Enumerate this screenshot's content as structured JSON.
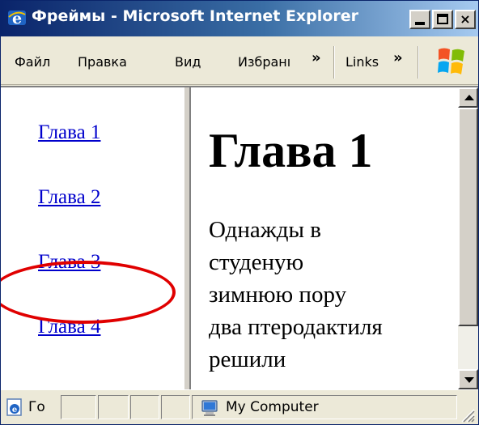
{
  "window": {
    "title": "Фреймы - Microsoft Internet Explorer",
    "icon": "ie-icon",
    "controls": {
      "minimize": "minimize-icon",
      "maximize": "maximize-icon",
      "close": "×"
    }
  },
  "menubar": {
    "items": [
      {
        "label": "Файл"
      },
      {
        "label": "Правка"
      },
      {
        "label": "Вид"
      },
      {
        "label": "Избранı"
      }
    ],
    "chevron": "»",
    "links_label": "Links",
    "links_chevron": "»",
    "logo": "windows-logo-icon"
  },
  "nav_frame": {
    "links": [
      {
        "label": "Глава 1"
      },
      {
        "label": "Глава 2"
      },
      {
        "label": "Глава 3"
      },
      {
        "label": "Глава 4"
      }
    ],
    "highlighted": "Глава 2"
  },
  "main_frame": {
    "heading": "Глава 1",
    "paragraph_lines": [
      "Однажды в",
      "студеную",
      "зимнюю пору",
      "два птеродактиля",
      "решили"
    ]
  },
  "statusbar": {
    "status": "Го",
    "zone": "My Computer"
  },
  "colors": {
    "link": "#0000cc",
    "highlight": "#e00000",
    "titlebar_start": "#0a246a",
    "chrome": "#ece9d8"
  }
}
